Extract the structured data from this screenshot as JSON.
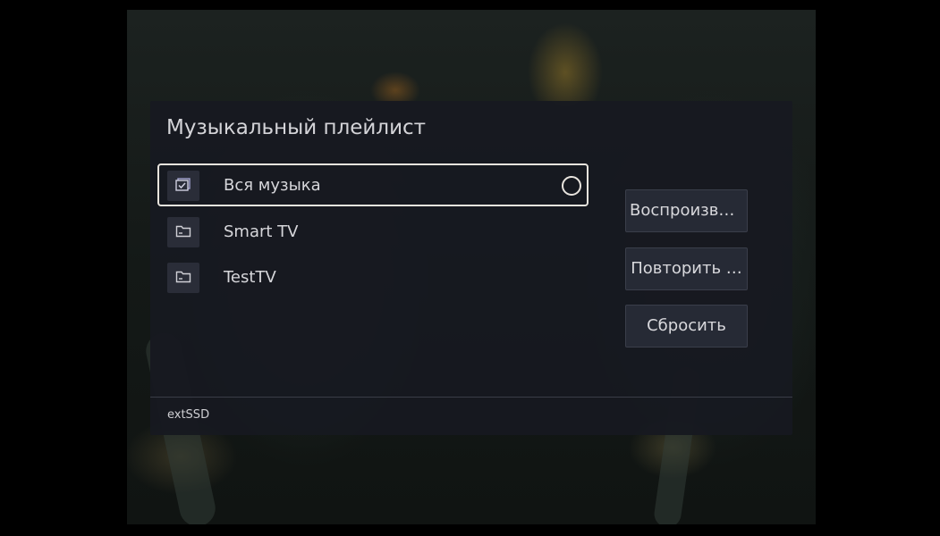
{
  "dialog": {
    "title": "Музыкальный плейлист",
    "items": [
      {
        "label": "Вся музыка",
        "icon": "playlist-check-icon",
        "focused": true,
        "radio": "unselected"
      },
      {
        "label": "Smart TV",
        "icon": "folder-icon"
      },
      {
        "label": "TestTV",
        "icon": "folder-icon"
      }
    ],
    "buttons": [
      {
        "label": "Воспроизве…"
      },
      {
        "label": "Повторить …"
      },
      {
        "label": "Сбросить"
      }
    ],
    "footer": {
      "source": "extSSD"
    }
  },
  "colors": {
    "dialog_bg": "#17191f",
    "focus_border": "#e8e4de",
    "button_bg": "#262a35",
    "text": "#d6d6da"
  }
}
